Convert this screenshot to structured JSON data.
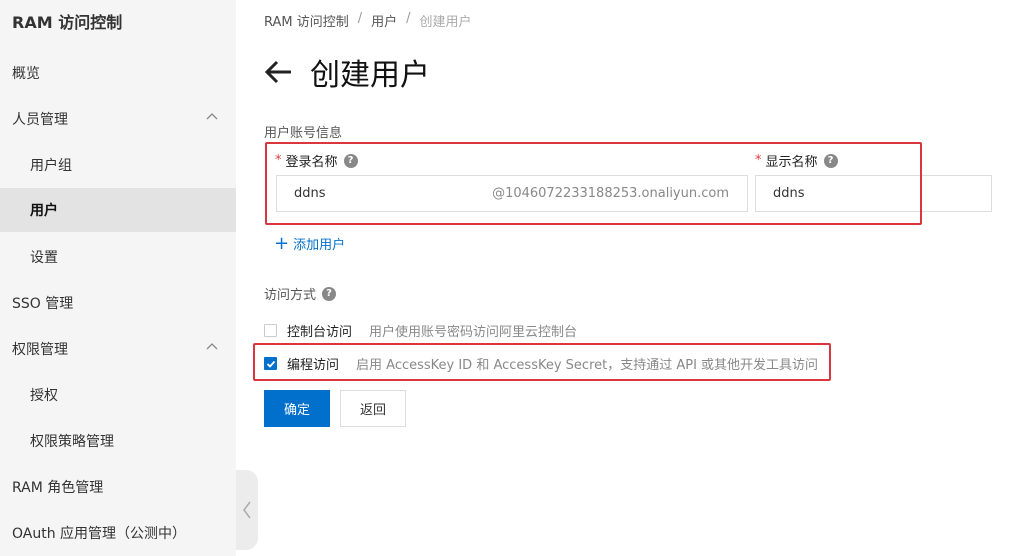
{
  "sidebar": {
    "title": "RAM 访问控制",
    "items": [
      {
        "label": "概览"
      },
      {
        "label": "人员管理"
      },
      {
        "label": "用户组"
      },
      {
        "label": "用户"
      },
      {
        "label": "设置"
      },
      {
        "label": "SSO 管理"
      },
      {
        "label": "权限管理"
      },
      {
        "label": "授权"
      },
      {
        "label": "权限策略管理"
      },
      {
        "label": "RAM 角色管理"
      },
      {
        "label": "OAuth 应用管理（公测中）"
      }
    ]
  },
  "breadcrumb": {
    "items": [
      "RAM 访问控制",
      "用户",
      "创建用户"
    ],
    "separator": "/"
  },
  "page": {
    "title": "创建用户"
  },
  "account_info": {
    "section_label": "用户账号信息",
    "login_name_label": "登录名称",
    "login_name_value": "ddns",
    "login_name_suffix": "@1046072233188253.onaliyun.com",
    "display_name_label": "显示名称",
    "display_name_value": "ddns",
    "required_mark": "*",
    "help_glyph": "?",
    "add_user": "添加用户",
    "add_plus": "+"
  },
  "access": {
    "section_label": "访问方式",
    "help_glyph": "?",
    "console": {
      "label": "控制台访问",
      "desc": "用户使用账号密码访问阿里云控制台",
      "checked": false
    },
    "programmatic": {
      "label": "编程访问",
      "desc": "启用 AccessKey ID 和 AccessKey Secret，支持通过 API 或其他开发工具访问",
      "checked": true
    }
  },
  "buttons": {
    "confirm": "确定",
    "back": "返回"
  },
  "colors": {
    "accent": "#0070cc",
    "highlight_box": "#d9363e",
    "sidebar_bg": "#f5f5f5"
  }
}
